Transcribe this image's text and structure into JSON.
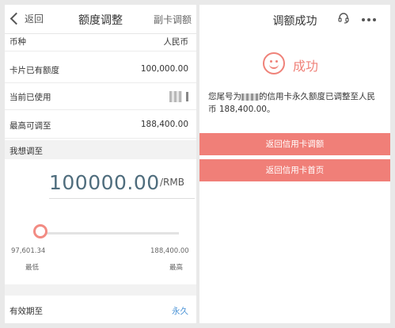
{
  "left": {
    "back_label": "返回",
    "title": "额度调整",
    "right_action": "副卡调额",
    "rows": [
      {
        "key": "币种",
        "value": "人民币"
      },
      {
        "key": "卡片已有额度",
        "value": "100,000.00"
      },
      {
        "key": "当前已使用",
        "value": ""
      },
      {
        "key": "最高可调至",
        "value": "188,400.00"
      }
    ],
    "section_title": "我想调至",
    "amount": "100000.00",
    "unit": "/RMB",
    "slider": {
      "min_value": "97,601.34",
      "max_value": "188,400.00",
      "min_label": "最低",
      "max_label": "最高",
      "fill_fraction": 0.03
    },
    "validity": {
      "key": "有效期至",
      "value": "永久"
    }
  },
  "right": {
    "title": "调额成功",
    "success_label": "成功",
    "message_prefix": "您尾号为",
    "message_suffix": "的信用卡永久额度已调整至人民币 188,400.00。",
    "buttons": [
      "返回信用卡调额",
      "返回信用卡首页"
    ]
  },
  "colors": {
    "accent": "#f07f78",
    "amount": "#4f6d7d",
    "link": "#4a93d6"
  }
}
